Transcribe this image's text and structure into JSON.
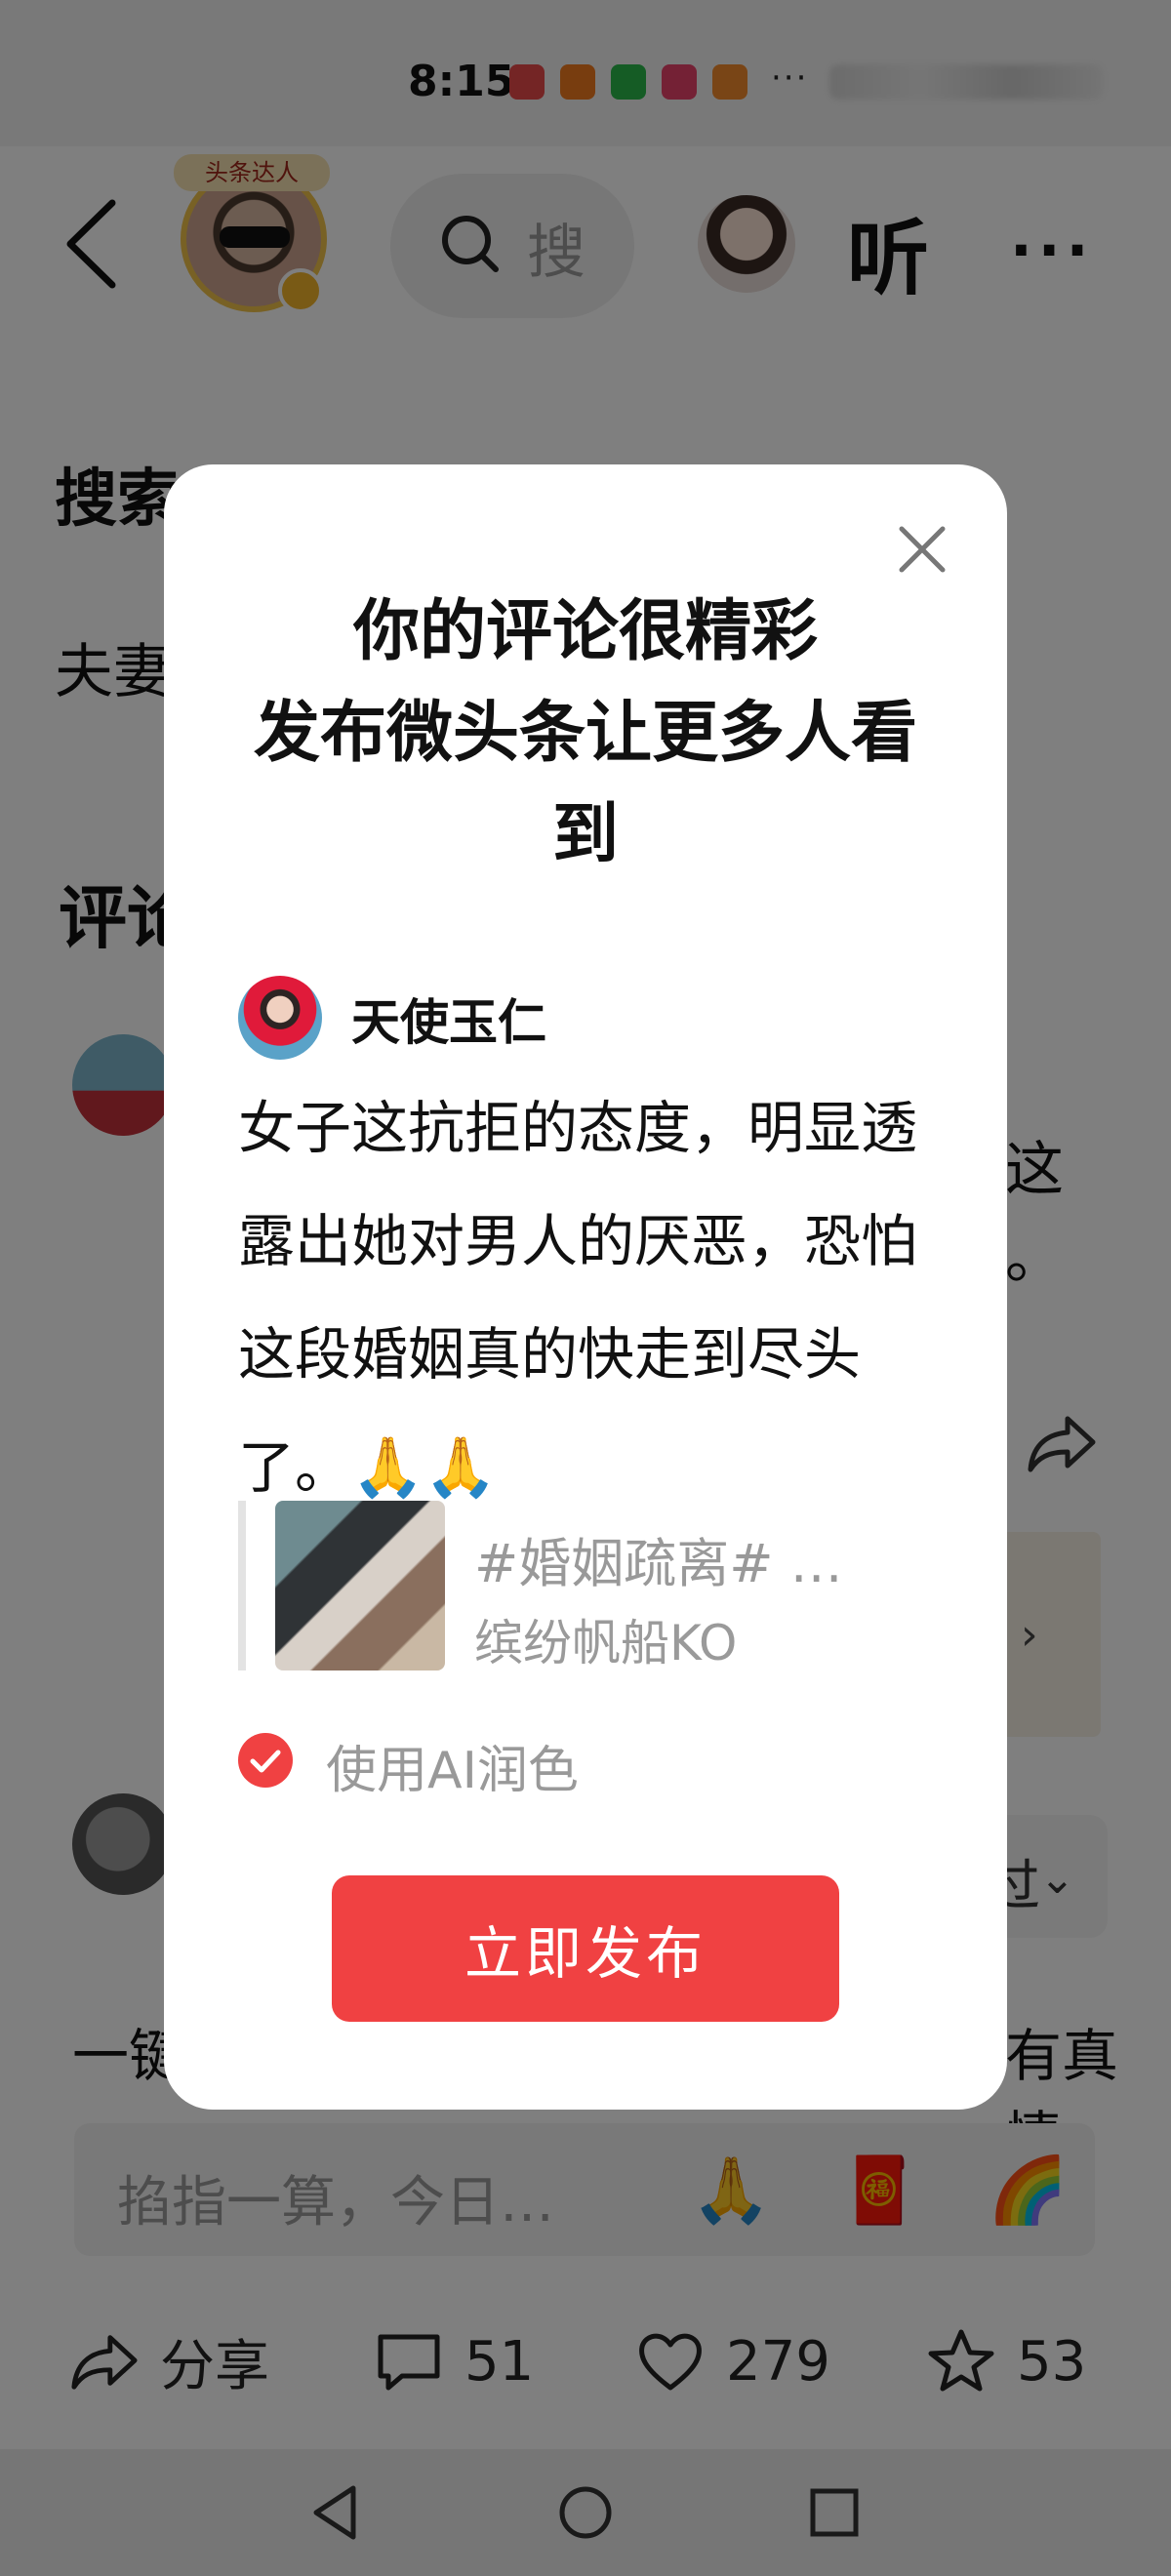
{
  "status_bar": {
    "time": "8:15",
    "more": "···"
  },
  "header": {
    "avatar_badge": "头条达人",
    "search_text": "搜",
    "listen": "听",
    "more": "···"
  },
  "background": {
    "section_title": "搜索",
    "line": "夫妻",
    "comments_title": "评论",
    "fragment_zhe": "这",
    "fragment_dot": "。",
    "pill_text": "过",
    "yijian": "一键",
    "zhenqing": "有真情"
  },
  "comment_input": {
    "placeholder": "掐指一算，今日…",
    "emojis": [
      "🙏",
      "🧧",
      "🌈"
    ]
  },
  "actions": {
    "share": "分享",
    "comments": "51",
    "likes": "279",
    "favorites": "53"
  },
  "modal": {
    "title_lines": [
      "你的评论很精彩",
      "发布微头条让更多人看",
      "到"
    ],
    "poster_name": "天使玉仁",
    "comment_text": "女子这抗拒的态度，明显透露出她对男人的厌恶，恐怕这段婚姻真的快走到尽头了。",
    "comment_emojis": "🙏🙏",
    "article_title": "#婚姻疏离# …",
    "article_author": "缤纷帆船KO",
    "ai_label": "使用AI润色",
    "publish_label": "立即发布"
  },
  "colors": {
    "accent": "#f04142",
    "overlay": "rgba(0,0,0,0.5)"
  }
}
